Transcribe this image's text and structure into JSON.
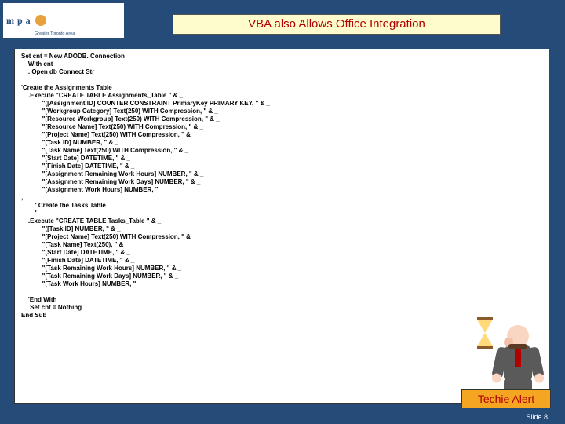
{
  "logo": {
    "mark": "mpa",
    "subtitle": "Greater Toronto Area"
  },
  "title": "VBA also Allows Office Integration",
  "code_lines": [
    "Set cnt = New ADODB. Connection",
    "    With cnt",
    "    . Open db Connect Str",
    "",
    "'Create the Assignments Table",
    "    .Execute \"CREATE TABLE Assignments_Table \" & _",
    "            \"([Assignment ID] COUNTER CONSTRAINT PrimaryKey PRIMARY KEY, \" & _",
    "            \"[Workgroup Category] Text(250) WITH Compression, \" & _",
    "            \"[Resource Workgroup] Text(250) WITH Compression, \" & _",
    "            \"[Resource Name] Text(250) WITH Compression, \" & _",
    "            \"[Project Name] Text(250) WITH Compression, \" & _",
    "            \"[Task ID] NUMBER, \" & _",
    "            \"[Task Name] Text(250) WITH Compression, \" & _",
    "            \"[Start Date] DATETIME, \" & _",
    "            \"[Finish Date] DATETIME, \" & _",
    "            \"[Assignment Remaining Work Hours] NUMBER, \" & _",
    "            \"[Assignment Remaining Work Days] NUMBER, \" & _",
    "            \"[Assignment Work Hours] NUMBER, \"",
    ",",
    "        ' Create the Tasks Table",
    "        '",
    "    .Execute \"CREATE TABLE Tasks_Table \" & _",
    "            \"([Task ID] NUMBER, \" & _",
    "            \"[Project Name] Text(250) WITH Compression, \" & _",
    "            \"[Task Name] Text(250), \" & _",
    "            \"[Start Date] DATETIME, \" & _",
    "            \"[Finish Date] DATETIME, \" & _",
    "            \"[Task Remaining Work Hours] NUMBER, \" & _",
    "            \"[Task Remaining Work Days] NUMBER, \" & _",
    "            \"[Task Work Hours] NUMBER, \"",
    "",
    "    'End With",
    "     Set cnt = Nothing",
    "End Sub"
  ],
  "alert": "Techie Alert",
  "slide_label": "Slide 8"
}
